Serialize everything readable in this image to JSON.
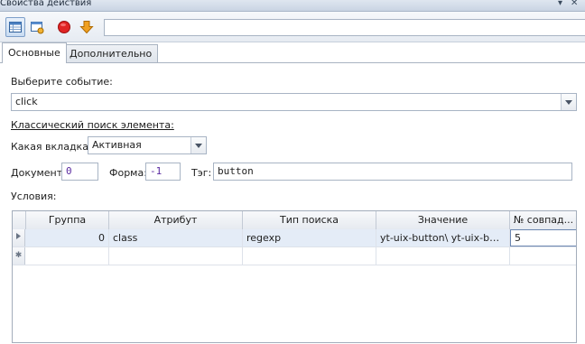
{
  "window": {
    "title": "Свойства действия",
    "pin_glyph": "▾",
    "close_glyph": "✕"
  },
  "toolbar": {
    "buttons": [
      {
        "icon": "table-view-icon",
        "active": true
      },
      {
        "icon": "window-settings-icon",
        "active": false
      },
      {
        "icon": "stop-record-icon",
        "color": "#e02424"
      },
      {
        "icon": "arrow-down-icon",
        "color": "#f0a020"
      }
    ],
    "input_value": ""
  },
  "tabs": [
    {
      "label": "Основные",
      "selected": true
    },
    {
      "label": "Дополнительно",
      "selected": false
    }
  ],
  "event": {
    "label": "Выберите событие:",
    "value": "click"
  },
  "classic_search": {
    "label": "Классический поиск элемента:"
  },
  "tab_select": {
    "label": "Какая вкладка:",
    "value": "Активная"
  },
  "document": {
    "label": "Документ:",
    "value": "0"
  },
  "form": {
    "label": "Форма:",
    "value": "-1"
  },
  "tag": {
    "label": "Тэг:",
    "value": "button"
  },
  "conditions": {
    "label": "Условия:",
    "columns": [
      "Группа",
      "Атрибут",
      "Тип поиска",
      "Значение",
      "№ совпад..."
    ],
    "rows": [
      {
        "group": "0",
        "attribute": "class",
        "search_type": "regexp",
        "value": "yt-uix-button\\ yt-uix-butt...",
        "match_no": "5"
      }
    ]
  },
  "colors": {
    "accent": "#7d9fc9",
    "selection": "#e4ecf7",
    "number": "#5a2aa0"
  }
}
